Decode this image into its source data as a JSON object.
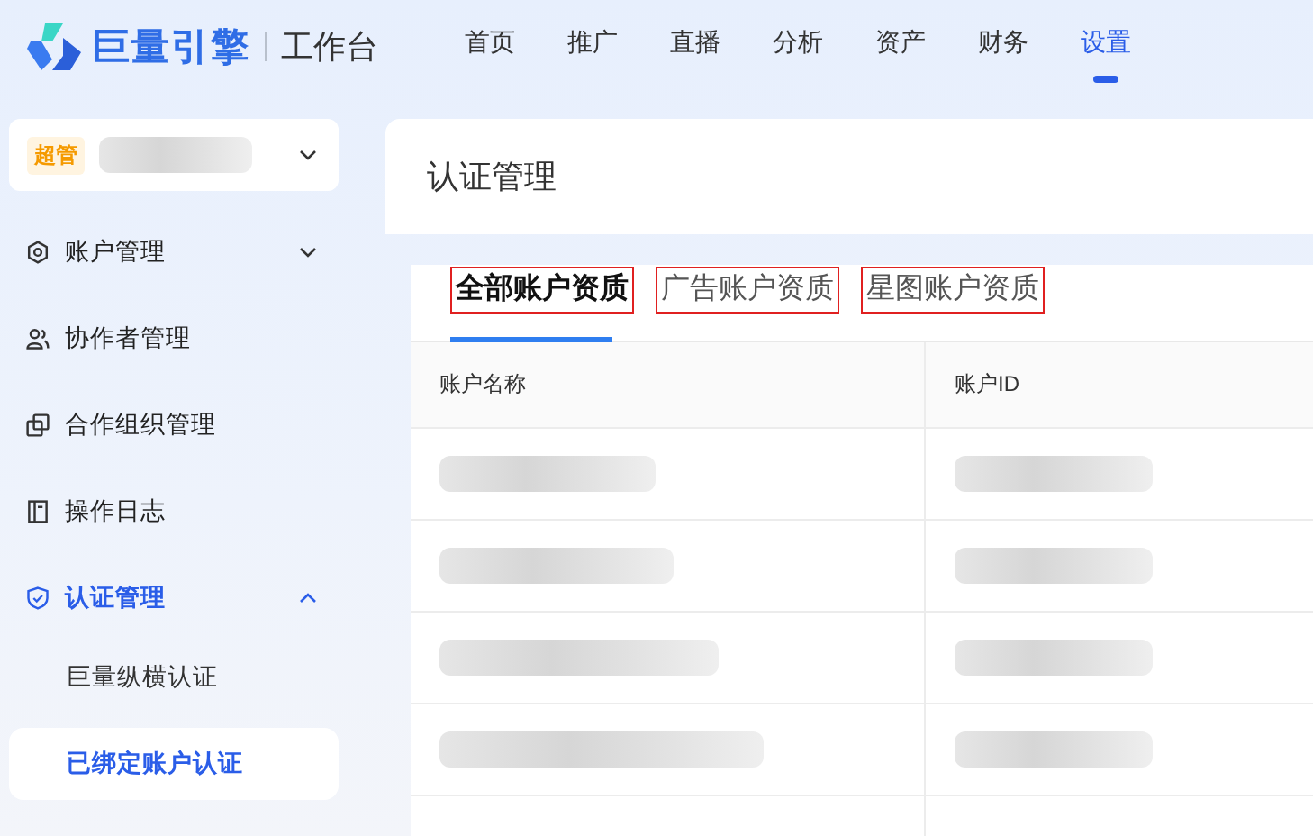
{
  "header": {
    "brand": "巨量引擎",
    "product": "工作台",
    "nav": [
      {
        "label": "首页",
        "selected": false
      },
      {
        "label": "推广",
        "selected": false
      },
      {
        "label": "直播",
        "selected": false
      },
      {
        "label": "分析",
        "selected": false
      },
      {
        "label": "资产",
        "selected": false
      },
      {
        "label": "财务",
        "selected": false
      },
      {
        "label": "设置",
        "selected": true
      }
    ]
  },
  "account": {
    "badge": "超管",
    "name": {
      "kind": "redacted"
    }
  },
  "sidebar": {
    "items": [
      {
        "label": "账户管理",
        "expanded": false,
        "selected": false
      },
      {
        "label": "协作者管理",
        "selected": false
      },
      {
        "label": "合作组织管理",
        "selected": false
      },
      {
        "label": "操作日志",
        "selected": false
      },
      {
        "label": "认证管理",
        "expanded": true,
        "selected": true,
        "children": [
          {
            "label": "巨量纵横认证",
            "selected": false
          },
          {
            "label": "已绑定账户认证",
            "selected": true
          }
        ]
      }
    ]
  },
  "page_title": "认证管理",
  "tabs": [
    {
      "label": "全部账户资质",
      "selected": true,
      "annotated": true
    },
    {
      "label": "广告账户资质",
      "selected": false,
      "annotated": true
    },
    {
      "label": "星图账户资质",
      "selected": false,
      "annotated": true
    }
  ],
  "table": {
    "columns": [
      "账户名称",
      "账户ID"
    ],
    "rows": [
      {
        "account_name": {
          "kind": "redacted"
        },
        "account_id": {
          "kind": "redacted"
        }
      },
      {
        "account_name": {
          "kind": "redacted"
        },
        "account_id": {
          "kind": "redacted"
        }
      },
      {
        "account_name": {
          "kind": "redacted"
        },
        "account_id": {
          "kind": "redacted"
        }
      },
      {
        "account_name": {
          "kind": "redacted"
        },
        "account_id": {
          "kind": "redacted"
        }
      }
    ]
  }
}
